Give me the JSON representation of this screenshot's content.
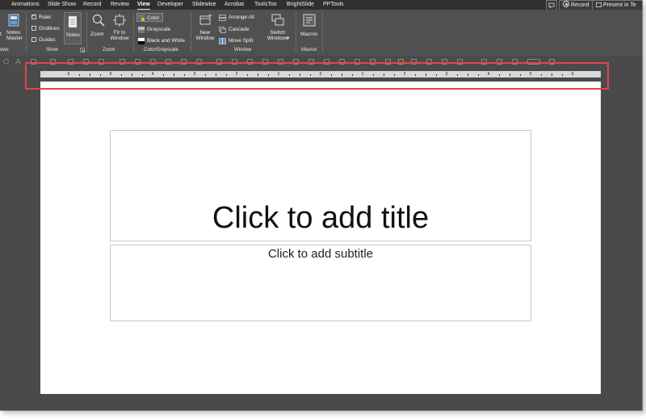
{
  "tabs": {
    "items": [
      "Animations",
      "Slide Show",
      "Record",
      "Review",
      "View",
      "Developer",
      "Slidewise",
      "Acrobat",
      "ToolsToo",
      "BrightSlide",
      "PPTools"
    ],
    "active": "View",
    "record_label": "Record",
    "present_label": "Present in Te"
  },
  "ribbon": {
    "views": {
      "label_truncated": "ews",
      "notes_master": [
        "Notes",
        "Master"
      ],
      "left_partial": "t"
    },
    "show": {
      "label": "Show",
      "ruler": {
        "label": "Ruler",
        "checked": true
      },
      "gridlines": {
        "label": "Gridlines",
        "checked": false
      },
      "guides": {
        "label": "Guides",
        "checked": false
      },
      "notes": "Notes"
    },
    "zoom": {
      "label": "Zoom",
      "zoom_btn": "Zoom",
      "fit_window": [
        "Fit to",
        "Window"
      ]
    },
    "color": {
      "label": "Color/Grayscale",
      "color": "Color",
      "grayscale": "Grayscale",
      "bw": "Black and White"
    },
    "window": {
      "label": "Window",
      "new_window": [
        "New",
        "Window"
      ],
      "arrange_all": "Arrange All",
      "cascade": "Cascade",
      "move_split": "Move Split",
      "switch_windows": [
        "Switch",
        "Windows"
      ]
    },
    "macros": {
      "label": "Macros",
      "macros_btn": "Macros"
    }
  },
  "ruler": {
    "numbers": [
      "6",
      "5",
      "4",
      "3",
      "2",
      "1",
      "0",
      "1",
      "2",
      "3",
      "4",
      "5",
      "6"
    ],
    "visible": true
  },
  "slide": {
    "title_placeholder": "Click to add title",
    "subtitle_placeholder": "Click to add subtitle"
  },
  "colors": {
    "accent_highlight": "#e0464a",
    "ribbon_bg": "#505050",
    "tab_bar": "#2f2f2f",
    "canvas_bg": "#4a4a4a"
  }
}
